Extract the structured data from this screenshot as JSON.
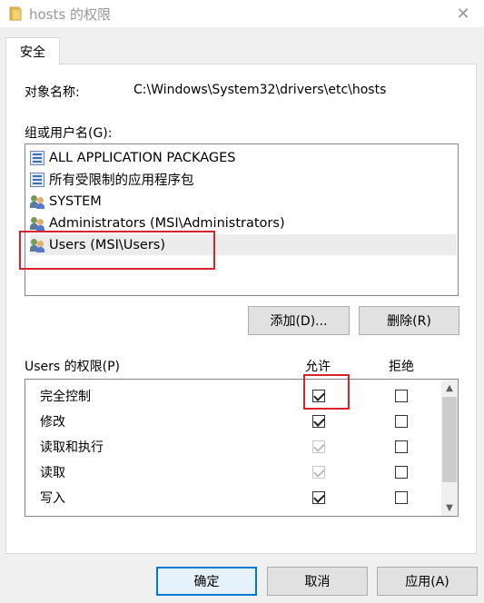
{
  "window": {
    "title": "hosts 的权限",
    "close_glyph": "✕"
  },
  "tabs": [
    {
      "label": "安全"
    }
  ],
  "object": {
    "label": "对象名称:",
    "value": "C:\\Windows\\System32\\drivers\\etc\\hosts"
  },
  "groups": {
    "label": "组或用户名(G):",
    "items": [
      {
        "name": "ALL APPLICATION PACKAGES",
        "icon": "package-icon"
      },
      {
        "name": "所有受限制的应用程序包",
        "icon": "package-icon"
      },
      {
        "name": "SYSTEM",
        "icon": "users-icon"
      },
      {
        "name": "Administrators (MSI\\Administrators)",
        "icon": "users-icon"
      },
      {
        "name": "Users (MSI\\Users)",
        "icon": "users-icon",
        "selected": true
      }
    ]
  },
  "buttons": {
    "add": "添加(D)...",
    "remove": "删除(R)",
    "ok": "确定",
    "cancel": "取消",
    "apply": "应用(A)"
  },
  "permissions": {
    "label": "Users 的权限(P)",
    "allow_header": "允许",
    "deny_header": "拒绝",
    "rows": [
      {
        "name": "完全控制",
        "allow": true,
        "allow_disabled": false,
        "deny": false
      },
      {
        "name": "修改",
        "allow": true,
        "allow_disabled": false,
        "deny": false
      },
      {
        "name": "读取和执行",
        "allow": true,
        "allow_disabled": true,
        "deny": false
      },
      {
        "name": "读取",
        "allow": true,
        "allow_disabled": true,
        "deny": false
      },
      {
        "name": "写入",
        "allow": true,
        "allow_disabled": false,
        "deny": false
      }
    ]
  },
  "colors": {
    "highlight": "#d9232b",
    "selection": "#ececec",
    "default_button_border": "#0078d7"
  }
}
